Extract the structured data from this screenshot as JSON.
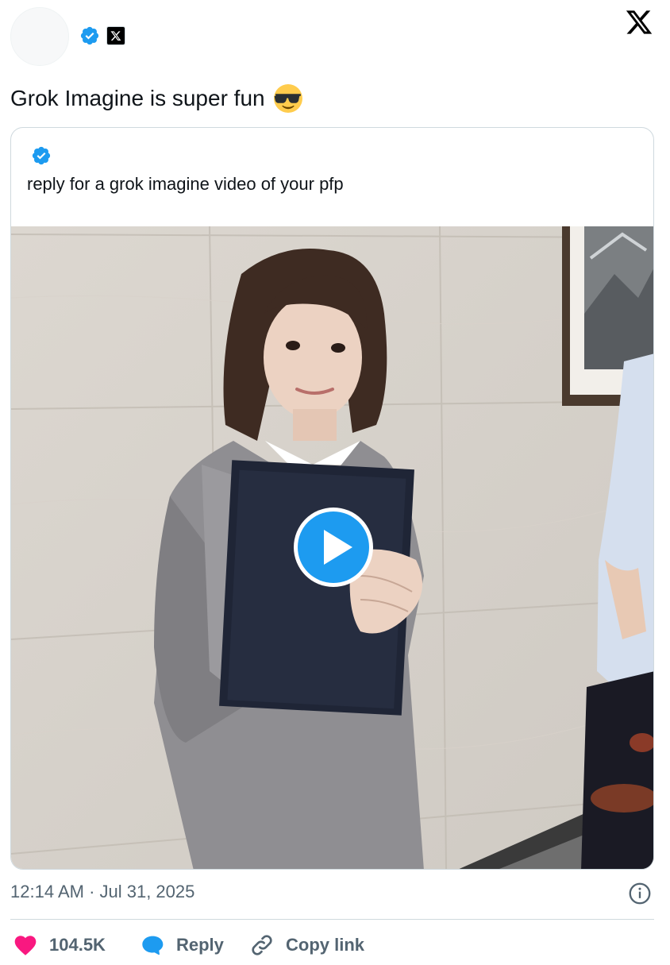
{
  "tweet": {
    "text": "Grok Imagine is super fun",
    "emoji": "smiling-face-with-sunglasses",
    "timestamp": "12:14 AM · Jul 31, 2025"
  },
  "quote": {
    "text": "reply for a grok imagine video of your pfp"
  },
  "actions": {
    "likes": "104.5K",
    "reply": "Reply",
    "copy_link": "Copy link"
  },
  "colors": {
    "verified_blue": "#1d9bf0",
    "like_pink": "#f91880",
    "text_secondary": "#536471",
    "border": "#cfd9de"
  },
  "icons": [
    "verified-badge-icon",
    "x-affiliate-badge-icon",
    "x-logo-icon",
    "play-icon",
    "info-icon",
    "heart-icon",
    "reply-bubble-icon",
    "link-icon"
  ]
}
